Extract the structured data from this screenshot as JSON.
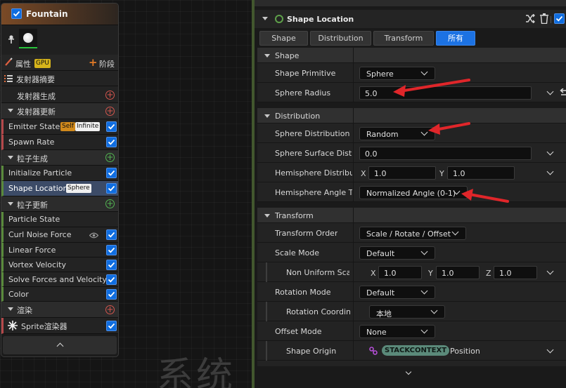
{
  "emitter": {
    "title": "Fountain",
    "properties_label": "属性",
    "gpu_badge": "GPU",
    "stage_button": "阶段",
    "sections": [
      {
        "label": "发射器摘要"
      },
      {
        "label": "发射器生成"
      },
      {
        "label": "发射器更新"
      },
      {
        "label": "粒子生成"
      },
      {
        "label": "粒子更新"
      },
      {
        "label": "渲染"
      }
    ],
    "modules": {
      "emitter_state": "Emitter State",
      "emitter_state_badge_self": "Self",
      "emitter_state_badge_infinite": "Infinite",
      "spawn_rate": "Spawn Rate",
      "initialize_particle": "Initialize Particle",
      "shape_location": "Shape Location",
      "shape_location_badge": "Sphere",
      "particle_state": "Particle State",
      "curl_noise_force": "Curl Noise Force",
      "linear_force": "Linear Force",
      "vortex_velocity": "Vortex Velocity",
      "solve_forces": "Solve Forces and Velocity",
      "color": "Color",
      "sprite_renderer": "Sprite渲染器"
    }
  },
  "background_glyphs": "系统",
  "panel": {
    "title": "Shape Location",
    "tabs": [
      "Shape",
      "Distribution",
      "Transform",
      "所有"
    ],
    "active_tab": "所有",
    "shape_section": "Shape",
    "shape_primitive_label": "Shape Primitive",
    "shape_primitive_value": "Sphere",
    "sphere_radius_label": "Sphere Radius",
    "sphere_radius_value": "5.0",
    "distribution_section": "Distribution",
    "sphere_distribution_label": "Sphere Distribution",
    "sphere_distribution_value": "Random",
    "sphere_surface_label": "Sphere Surface Distri",
    "sphere_surface_value": "0.0",
    "hemisphere_distribution_label": "Hemisphere Distribut",
    "hemisphere_x": "1.0",
    "hemisphere_y": "1.0",
    "hemisphere_angle_label": "Hemisphere Angle Ty",
    "hemisphere_angle_value": "Normalized Angle (0-1)",
    "transform_section": "Transform",
    "transform_order_label": "Transform Order",
    "transform_order_value": "Scale / Rotate / Offset",
    "scale_mode_label": "Scale Mode",
    "scale_mode_value": "Default",
    "non_uniform_scale_label": "Non Uniform Scale",
    "scale_x": "1.0",
    "scale_y": "1.0",
    "scale_z": "1.0",
    "rotation_mode_label": "Rotation Mode",
    "rotation_mode_value": "Default",
    "rotation_coord_label": "Rotation Coordina",
    "rotation_coord_value": "本地",
    "offset_mode_label": "Offset Mode",
    "offset_mode_value": "None",
    "shape_origin_label": "Shape Origin",
    "shape_origin_badge": "STACKCONTEXT",
    "shape_origin_value": "Position",
    "axis_x": "X",
    "axis_y": "Y",
    "axis_z": "Z"
  },
  "colors": {
    "accent_blue": "#1c72e3",
    "annotation_red": "#e0262a",
    "module_green": "#5a8a3c"
  }
}
